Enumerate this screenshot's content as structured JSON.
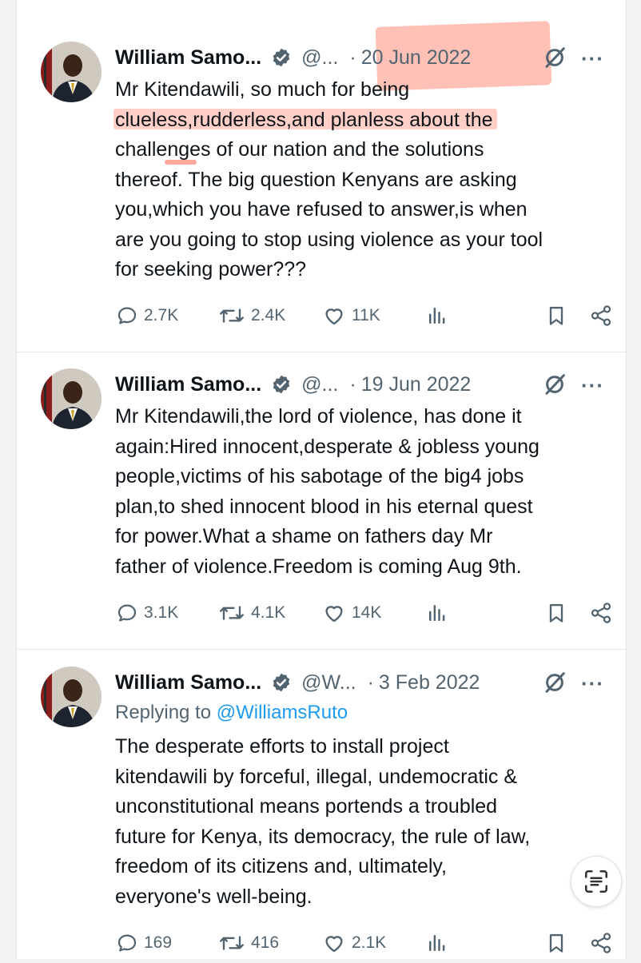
{
  "tweets": [
    {
      "name": "William Samo...",
      "handle": "@...",
      "date": "20 Jun 2022",
      "text": "Mr Kitendawili, so much for being\nclueless,rudderless,and planless about the\nchallenges of our nation and the solutions\nthereof. The big question Kenyans are asking\nyou,which you have refused to answer,is when\nare you going to stop using violence as your tool\nfor seeking power???",
      "stats": {
        "replies": "2.7K",
        "reposts": "2.4K",
        "likes": "11K"
      }
    },
    {
      "name": "William Samo...",
      "handle": "@...",
      "date": "19 Jun 2022",
      "text": "Mr Kitendawili,the lord of violence, has done it\nagain:Hired innocent,desperate & jobless young\npeople,victims of his sabotage of the big4 jobs\nplan,to shed innocent blood in his eternal quest\nfor power.What a shame on fathers day Mr\nfather of violence.Freedom is coming Aug 9th.",
      "stats": {
        "replies": "3.1K",
        "reposts": "4.1K",
        "likes": "14K"
      }
    },
    {
      "name": "William Samo...",
      "handle": "@W...",
      "date": "3 Feb 2022",
      "replying_to_label": "Replying to ",
      "replying_to_handle": "@WilliamsRuto",
      "text": "The desperate efforts to install project\nkitendawili by forceful, illegal, undemocratic &\nunconstitutional means portends a troubled\nfuture for Kenya, its democracy, the rule of law,\nfreedom of its citizens and, ultimately,\neveryone's well-being.",
      "stats": {
        "replies": "169",
        "reposts": "416",
        "likes": "2.1K"
      }
    }
  ],
  "ui": {
    "dot": "·",
    "more": "···"
  },
  "colors": {
    "verified": "#536471",
    "highlight": "#ff8c78",
    "link": "#1d9bf0"
  }
}
